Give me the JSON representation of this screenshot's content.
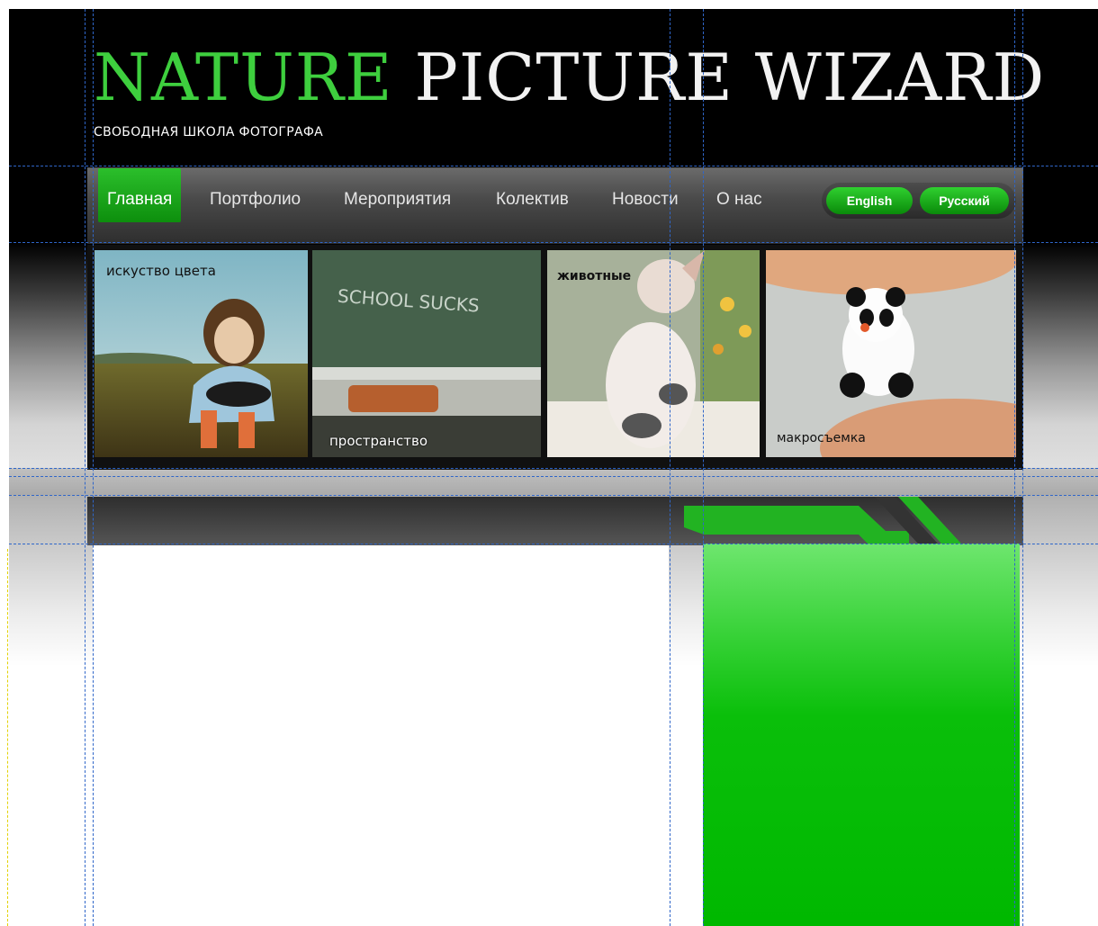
{
  "header": {
    "logo_word1": "NATURE",
    "logo_word2": "PICTURE WIZARD",
    "tagline": "СВОБОДНАЯ ШКОЛА ФОТОГРАФА"
  },
  "nav": {
    "items": [
      {
        "label": "Главная",
        "active": true
      },
      {
        "label": "Портфолио",
        "active": false
      },
      {
        "label": "Мероприятия",
        "active": false
      },
      {
        "label": "Колектив",
        "active": false
      },
      {
        "label": "Новости",
        "active": false
      },
      {
        "label": "О нас",
        "active": false
      }
    ],
    "languages": [
      "English",
      "Русский"
    ]
  },
  "gallery": {
    "tiles": [
      {
        "label": "искуство цвета",
        "icon": "girl-in-field-photo"
      },
      {
        "label": "пространство",
        "icon": "chalkboard-photo",
        "chalk_text": "SCHOOL SUCKS"
      },
      {
        "label": "животные",
        "icon": "kitten-photo"
      },
      {
        "label": "макросъемка",
        "icon": "panda-figurine-photo"
      }
    ]
  },
  "colors": {
    "accent_green": "#1fc41f",
    "logo_green": "#3ecf3e",
    "header_bg": "#000000",
    "guide_blue": "#2f66c9"
  }
}
